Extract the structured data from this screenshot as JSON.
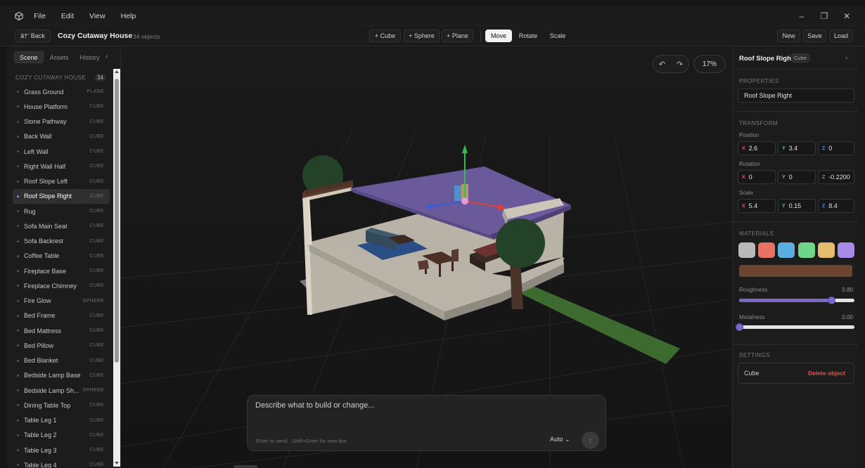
{
  "menu": [
    "File",
    "Edit",
    "View",
    "Help"
  ],
  "window_controls": {
    "minimize": "–",
    "maximize": "❐",
    "close": "✕"
  },
  "toolbar": {
    "back_label": "â†‘ Back",
    "scene_title": "Cozy Cutaway House",
    "object_count": "34 objects",
    "add_cube": "+ Cube",
    "add_sphere": "+ Sphere",
    "add_plane": "+ Plane",
    "tool_move": "Move",
    "tool_rotate": "Rotate",
    "tool_scale": "Scale",
    "active_tool": "Move",
    "new_label": "New",
    "save_label": "Save",
    "load_label": "Load"
  },
  "left_panel": {
    "tabs": [
      "Scene",
      "Assets",
      "History"
    ],
    "active_tab": "Scene",
    "collapse_icon": "‹",
    "group_title": "COZY CUTAWAY HOUSE",
    "group_count": "34",
    "selected": "Roof Slope Right",
    "objects": [
      {
        "name": "Grass Ground",
        "type": "PLANE"
      },
      {
        "name": "House Platform",
        "type": "CUBE"
      },
      {
        "name": "Stone Pathway",
        "type": "CUBE"
      },
      {
        "name": "Back Wall",
        "type": "CUBE"
      },
      {
        "name": "Left Wall",
        "type": "CUBE"
      },
      {
        "name": "Right Wall Half",
        "type": "CUBE"
      },
      {
        "name": "Roof Slope Left",
        "type": "CUBE"
      },
      {
        "name": "Roof Slope Right",
        "type": "CUBE"
      },
      {
        "name": "Rug",
        "type": "CUBE"
      },
      {
        "name": "Sofa Main Seat",
        "type": "CUBE"
      },
      {
        "name": "Sofa Backrest",
        "type": "CUBE"
      },
      {
        "name": "Coffee Table",
        "type": "CUBE"
      },
      {
        "name": "Fireplace Base",
        "type": "CUBE"
      },
      {
        "name": "Fireplace Chimney",
        "type": "CUBE"
      },
      {
        "name": "Fire Glow",
        "type": "SPHERE"
      },
      {
        "name": "Bed Frame",
        "type": "CUBE"
      },
      {
        "name": "Bed Mattress",
        "type": "CUBE"
      },
      {
        "name": "Bed Pillow",
        "type": "CUBE"
      },
      {
        "name": "Bed Blanket",
        "type": "CUBE"
      },
      {
        "name": "Bedside Lamp Base",
        "type": "CUBE"
      },
      {
        "name": "Bedside Lamp Sh...",
        "type": "SPHERE"
      },
      {
        "name": "Dining Table Top",
        "type": "CUBE"
      },
      {
        "name": "Table Leg 1",
        "type": "CUBE"
      },
      {
        "name": "Table Leg 2",
        "type": "CUBE"
      },
      {
        "name": "Table Leg 3",
        "type": "CUBE"
      },
      {
        "name": "Table Leg 4",
        "type": "CUBE"
      }
    ]
  },
  "viewport": {
    "undo_icon": "↶",
    "redo_icon": "↷",
    "zoom": "17%",
    "prompt_placeholder": "Describe what to build or change...",
    "prompt_hint": "Enter to send · Shift+Enter for new line",
    "mode_select": "Auto ⌄",
    "send_icon": "↑"
  },
  "right_panel": {
    "object_name": "Roof Slope Right",
    "object_type": "Cube",
    "chevron": "›",
    "properties_label": "PROPERTIES",
    "name_value": "Roof Slope Right",
    "transform_label": "TRANSFORM",
    "position_label": "Position",
    "position": {
      "x": "2.6",
      "y": "3.4",
      "z": "0"
    },
    "rotation_label": "Rotation",
    "rotation": {
      "x": "0",
      "y": "0",
      "z": "-0.2200"
    },
    "scale_label": "Scale",
    "scale": {
      "x": "5.4",
      "y": "0.15",
      "z": "8.4"
    },
    "materials_label": "MATERIALS",
    "swatches": [
      "#b9b9b9",
      "#e57364",
      "#5aaee0",
      "#6ed58a",
      "#e3bd6d",
      "#a88be8"
    ],
    "current_color": "#6b4530",
    "roughness_label": "Roughness",
    "roughness_value": "0.80",
    "roughness": 0.8,
    "metalness_label": "Metalness",
    "metalness_value": "0.00",
    "metalness": 0.0,
    "settings_label": "SETTINGS",
    "settings_type": "Cube",
    "delete_label": "Delete object"
  },
  "colors": {
    "accent": "#7b68c8",
    "roof": "#6a5a9c",
    "danger": "#e2554f",
    "grass": "#3d6a2f"
  }
}
